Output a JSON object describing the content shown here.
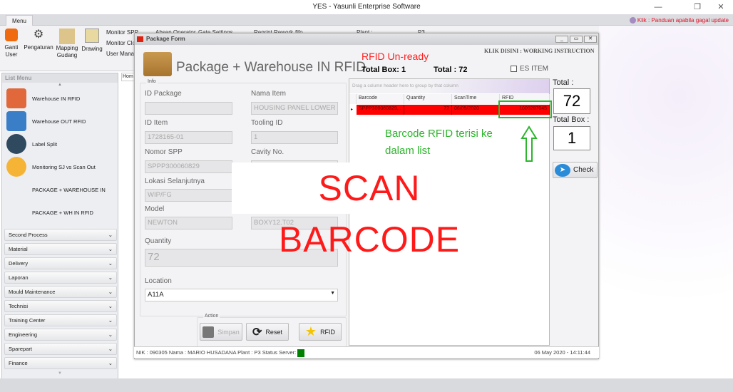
{
  "app": {
    "title": "YES - Yasunli Enterprise Software",
    "menu_tab": "Menu",
    "update_link": "Klik : Panduan apabila gagal update"
  },
  "ribbon": {
    "buttons": [
      {
        "label": "Ganti User",
        "icon": "key-icon"
      },
      {
        "label": "Pengaturan",
        "icon": "gears-icon"
      },
      {
        "label": "Mapping Gudang",
        "icon": "boxes-icon"
      },
      {
        "label": "Drawing",
        "icon": "drawing-icon"
      }
    ],
    "links": [
      "Monitor SPP",
      "Monitor Clos",
      "User Manag",
      "Absen Operator",
      "Gate Settings",
      "Reprint Rework",
      "fifo"
    ],
    "plant_label": "Plant :",
    "plant_value": "P3"
  },
  "sidebar": {
    "title": "List Menu",
    "items": [
      {
        "label": "Warehouse IN RFID",
        "color": "#e0683a"
      },
      {
        "label": "Warehouse OUT RFID",
        "color": "#3a7ec8"
      },
      {
        "label": "Label Split",
        "color": "#2f4a5e"
      },
      {
        "label": "Monitoring SJ vs Scan Out",
        "color": "#f6b436"
      },
      {
        "label": "PACKAGE + WAREHOUSE IN"
      },
      {
        "label": "PACKAGE + WH IN RFID"
      }
    ],
    "categories": [
      "Second Process",
      "Material",
      "Delivery",
      "Laporan",
      "Mould Maintenance",
      "Technisi",
      "Training Center",
      "Engineering",
      "Sparepart",
      "Finance"
    ]
  },
  "home_tab": "Hom",
  "form": {
    "window_title": "Package Form",
    "title": "Package + Warehouse IN RFID",
    "rfid_status": "RFID Un-ready",
    "total_box_label": "Total Box: 1",
    "total_label": "Total : 72",
    "es_item": "ES ITEM",
    "working_instruction": "KLIK DISINI : WORKING INSTRUCTION",
    "info_group": "Info",
    "fields": {
      "id_package": {
        "label": "ID Package",
        "value": ""
      },
      "nama_item": {
        "label": "Nama Item",
        "value": "HOUSING PANEL LOWER"
      },
      "id_item": {
        "label": "ID Item",
        "value": "1728165-01"
      },
      "tooling_id": {
        "label": "Tooling ID",
        "value": "1"
      },
      "nomor_spp": {
        "label": "Nomor SPP",
        "value": "SPPP300060829"
      },
      "cavity_no": {
        "label": "Cavity No.",
        "value": ""
      },
      "lokasi": {
        "label": "Lokasi Selanjutnya",
        "value": "WIP/FG"
      },
      "model": {
        "label": "Model",
        "value": "NEWTON"
      },
      "box": {
        "value": "BOXY12.T02"
      },
      "quantity": {
        "label": "Quantity",
        "value": "72"
      },
      "location": {
        "label": "Location",
        "value": "A11A"
      }
    },
    "action_group": "Action",
    "buttons": {
      "simpan": "Simpan",
      "reset": "Reset",
      "rfid": "RFID",
      "check": "Check"
    },
    "grid": {
      "group_hint": "Drag a column header here to group by that column",
      "columns": [
        "Barcode",
        "Quantity",
        "ScanTime",
        "RFID"
      ],
      "rows": [
        [
          "SPPP300060829...",
          "72",
          "06/05/2020",
          "1000287045"
        ]
      ],
      "row_color": "#ff0000"
    },
    "total": {
      "label": "Total :",
      "value": "72"
    },
    "total_box": {
      "label": "Total Box :",
      "value": "1"
    },
    "status": {
      "text": "NIK :   090305  Nama :  MARIO HUSADANA  Plant :  P3  Status Server:",
      "server_color": "#008000",
      "datetime": "06 May 2020 - 14:11:44"
    }
  },
  "annotations": {
    "scan": "SCAN BARCODE",
    "note": "Barcode RFID terisi ke dalam list",
    "color": "#2db52d"
  }
}
